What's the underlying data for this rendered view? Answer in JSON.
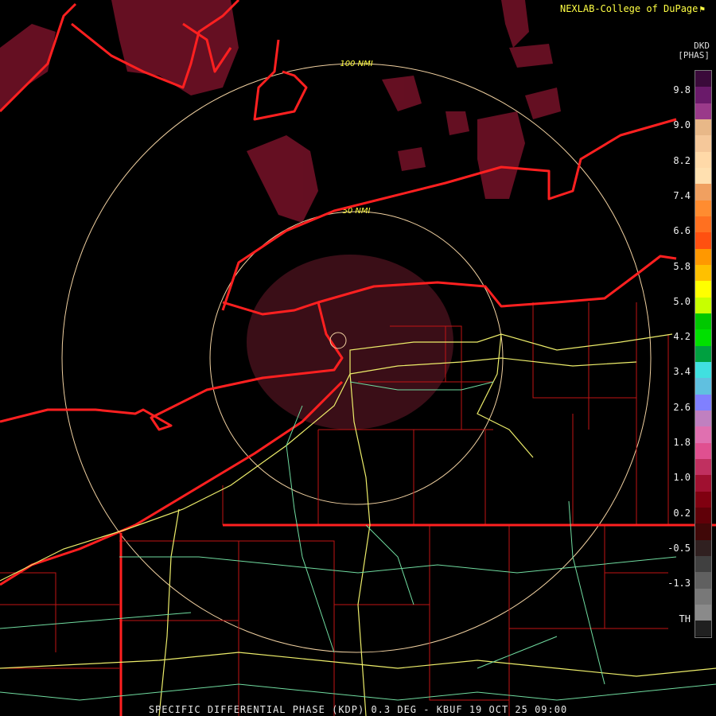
{
  "credit": {
    "text": "NEXLAB-College of DuPage",
    "icon": "flag-icon"
  },
  "caption": "SPECIFIC DIFFERENTIAL PHASE (KDP) 0.3 DEG - KBUF 19 OCT 25 09:00",
  "legend": {
    "product": "DKD",
    "unit": "[PHAS]",
    "labels": [
      "9.8",
      "9.0",
      "8.2",
      "7.4",
      "6.6",
      "5.8",
      "5.0",
      "4.2",
      "3.4",
      "2.6",
      "1.8",
      "1.0",
      "0.2",
      "-0.5",
      "-1.3",
      "TH"
    ],
    "colors": [
      "#3a0a3a",
      "#6a1a6a",
      "#9a3a8a",
      "#e8b888",
      "#f5c89a",
      "#ffd9a8",
      "#ffe0b0",
      "#f0a060",
      "#ff8c30",
      "#ff7020",
      "#ff5010",
      "#ff9800",
      "#ffc000",
      "#ffff00",
      "#c8ff00",
      "#00c800",
      "#00e000",
      "#00a040",
      "#40e0e0",
      "#60c0e0",
      "#8080ff",
      "#c080c0",
      "#e070b0",
      "#e05090",
      "#c03060",
      "#a01030",
      "#800010",
      "#600008",
      "#400808",
      "#302020",
      "#404040",
      "#606060",
      "#787878",
      "#8a8a8a",
      "#202020"
    ]
  },
  "rings": [
    {
      "label": "100 NMI"
    },
    {
      "label": "50 NMI"
    }
  ],
  "colors": {
    "boundary": "#ff2020",
    "county": "#d01818",
    "highway": "#f0f070",
    "road": "#70e0a0",
    "ring": "#f0d0a0",
    "ring_label": "#ffff40"
  }
}
